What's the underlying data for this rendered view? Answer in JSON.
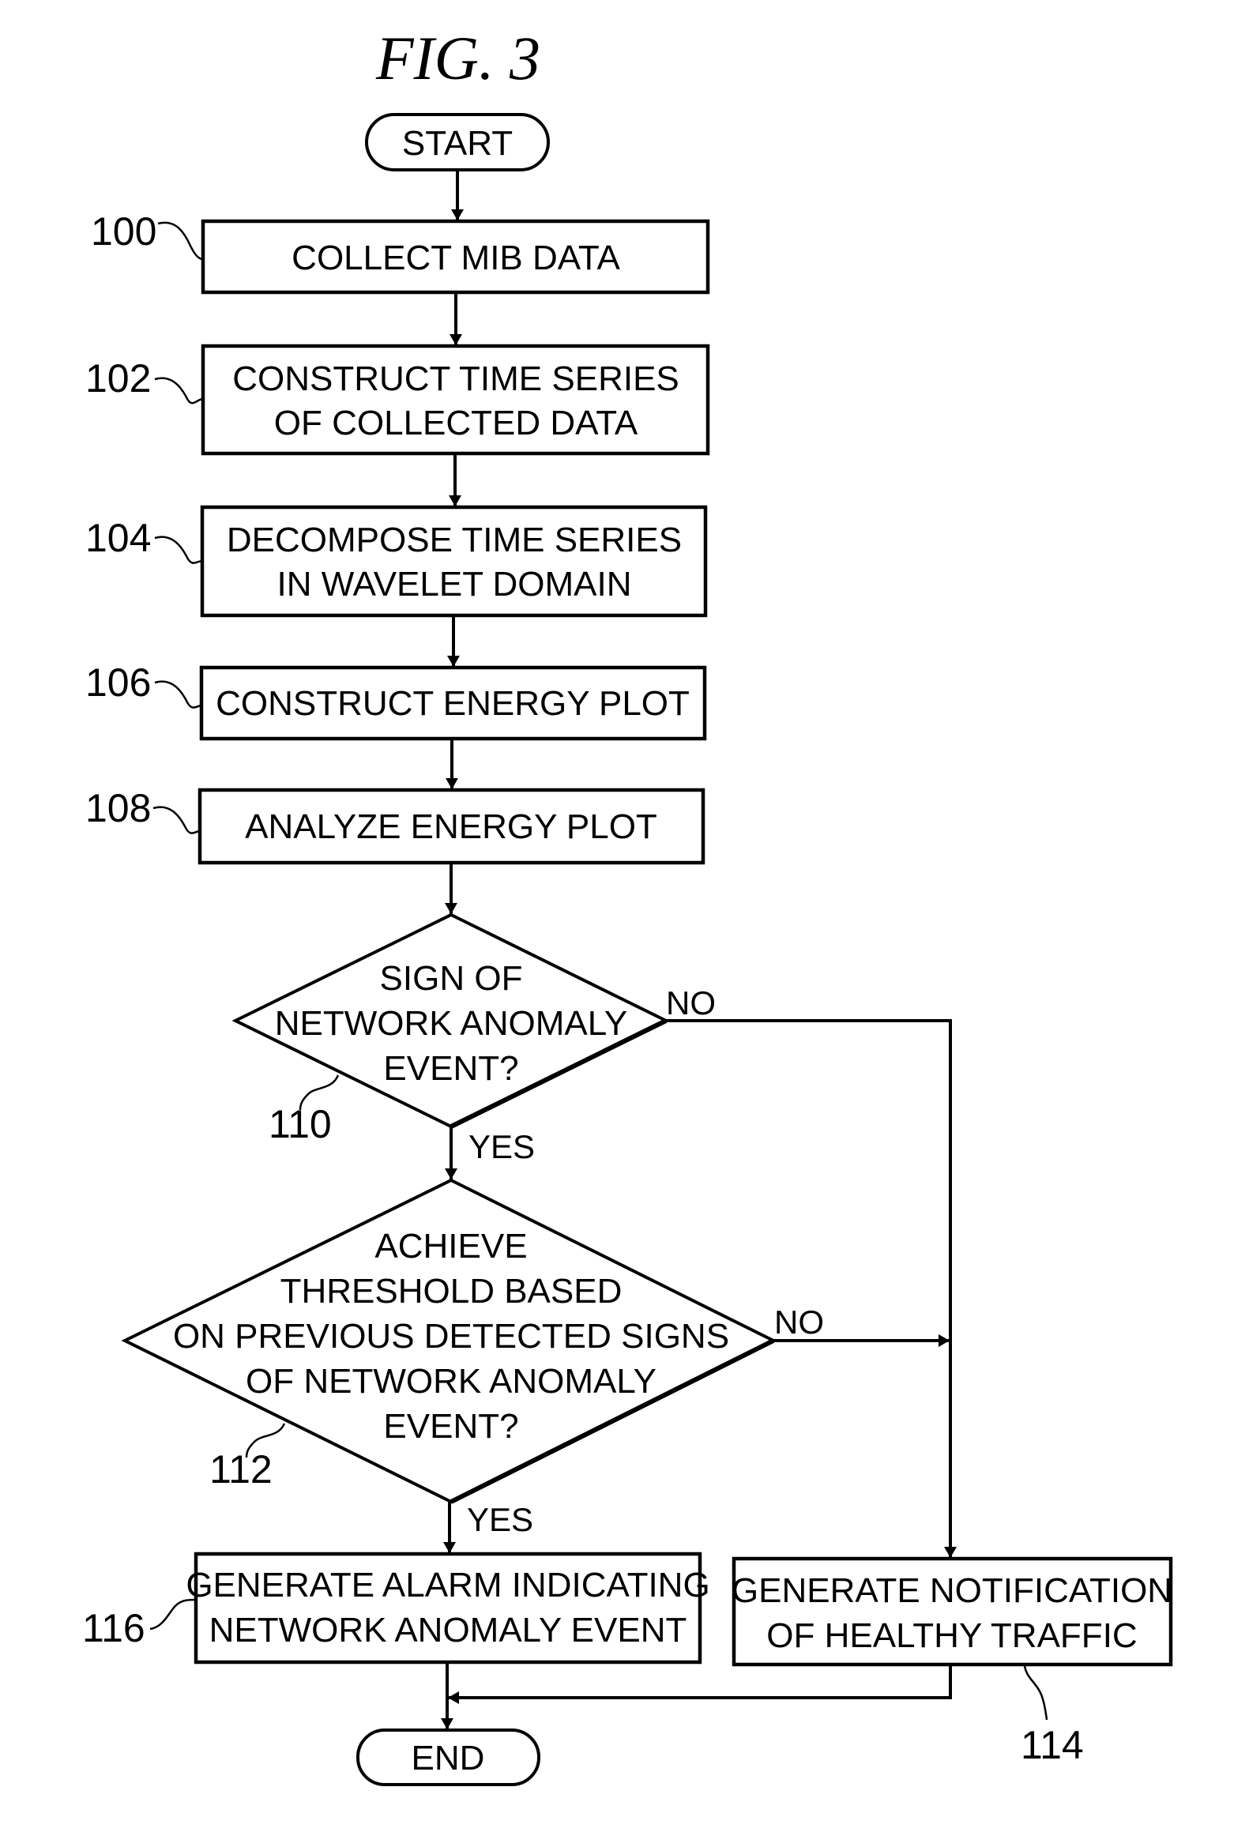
{
  "figure": {
    "title": "FIG. 3"
  },
  "nodes": {
    "start": {
      "label": "START"
    },
    "step100": {
      "ref": "100",
      "lines": [
        "COLLECT MIB DATA"
      ]
    },
    "step102": {
      "ref": "102",
      "lines": [
        "CONSTRUCT TIME SERIES",
        "OF COLLECTED DATA"
      ]
    },
    "step104": {
      "ref": "104",
      "lines": [
        "DECOMPOSE TIME SERIES",
        "IN WAVELET DOMAIN"
      ]
    },
    "step106": {
      "ref": "106",
      "lines": [
        "CONSTRUCT ENERGY PLOT"
      ]
    },
    "step108": {
      "ref": "108",
      "lines": [
        "ANALYZE ENERGY PLOT"
      ]
    },
    "decision110": {
      "ref": "110",
      "lines": [
        "SIGN OF",
        "NETWORK ANOMALY",
        "EVENT?"
      ],
      "yes": "YES",
      "no": "NO"
    },
    "decision112": {
      "ref": "112",
      "lines": [
        "ACHIEVE",
        "THRESHOLD BASED",
        "ON PREVIOUS DETECTED SIGNS",
        "OF NETWORK ANOMALY",
        "EVENT?"
      ],
      "yes": "YES",
      "no": "NO"
    },
    "step114": {
      "ref": "114",
      "lines": [
        "GENERATE NOTIFICATION",
        "OF HEALTHY TRAFFIC"
      ]
    },
    "step116": {
      "ref": "116",
      "lines": [
        "GENERATE ALARM INDICATING",
        "NETWORK ANOMALY EVENT"
      ]
    },
    "end": {
      "label": "END"
    }
  }
}
